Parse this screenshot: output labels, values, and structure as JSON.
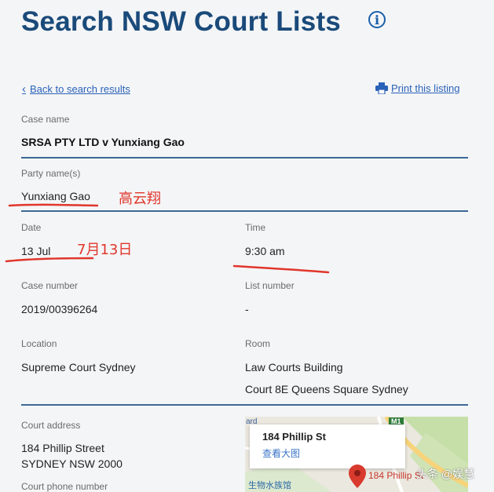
{
  "header": {
    "title": "Search NSW Court Lists",
    "info_icon_glyph": "i"
  },
  "nav": {
    "back_label": "Back to search results",
    "print_label": "Print this listing"
  },
  "details": {
    "case_name_label": "Case name",
    "case_name": "SRSA PTY LTD v Yunxiang Gao",
    "party_label": "Party name(s)",
    "party": "Yunxiang Gao",
    "date_label": "Date",
    "date": "13 Jul",
    "time_label": "Time",
    "time": "9:30 am",
    "case_number_label": "Case number",
    "case_number": "2019/00396264",
    "list_number_label": "List number",
    "list_number": "-",
    "location_label": "Location",
    "location": "Supreme Court Sydney",
    "room_label": "Room",
    "room_line1": "Law Courts Building",
    "room_line2": "Court 8E Queens Square Sydney",
    "court_address_label": "Court address",
    "court_address_line1": "184 Phillip Street",
    "court_address_line2": "SYDNEY NSW 2000",
    "court_phone_label": "Court phone number"
  },
  "annotations": {
    "party_cn": "高云翔",
    "date_cn": "7月13日",
    "color": "#e1362b"
  },
  "map": {
    "popup_title": "184 Phillip St",
    "popup_link": "查看大图",
    "pin_label": "184 Phillip St",
    "museum_label": "生物水族馆",
    "road_badge": "M1",
    "edge_text": "ard"
  },
  "watermark": "头条 @娱慧",
  "colors": {
    "title": "#1a4a7a",
    "link": "#2a62b8",
    "divider": "#3c6896"
  }
}
